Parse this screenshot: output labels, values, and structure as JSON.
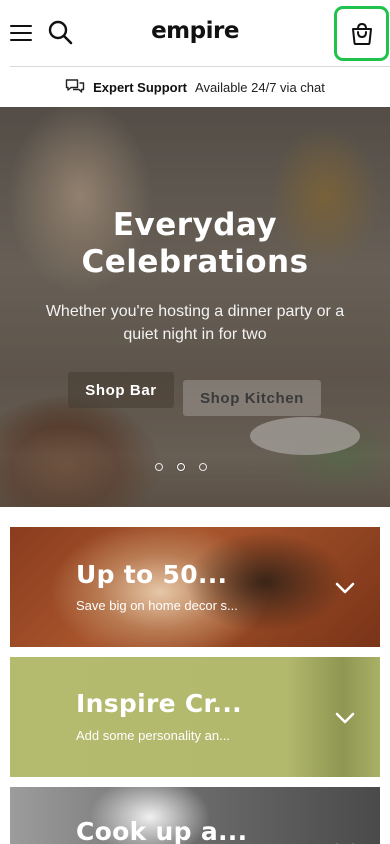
{
  "header": {
    "logo": "empire",
    "menu_icon": "hamburger-menu-icon",
    "search_icon": "search-icon",
    "cart_icon": "shopping-bag-icon"
  },
  "support": {
    "icon": "chat-bubbles-icon",
    "title": "Expert Support",
    "subtitle": "Available 24/7 via chat"
  },
  "hero": {
    "title_line1": "Everyday",
    "title_line2": "Celebrations",
    "subtitle": "Whether you're hosting a dinner party or a quiet night in for two",
    "buttons": [
      {
        "label": "Shop Bar"
      },
      {
        "label": "Shop Kitchen"
      }
    ],
    "slides_count": 3,
    "active_slide": 2
  },
  "promos": [
    {
      "title": "Up to 50...",
      "subtitle": "Save big on home decor s...",
      "icon": "chevron-down-icon"
    },
    {
      "title": "Inspire Cr...",
      "subtitle": "Add some personality an...",
      "icon": "chevron-down-icon"
    },
    {
      "title": "Cook up a...",
      "subtitle": "",
      "icon": "chevron-down-icon"
    }
  ],
  "colors": {
    "cart_highlight": "#1fc24a",
    "card_olive": "#b5bb6e",
    "card_terracotta": "#8a3c1e"
  }
}
